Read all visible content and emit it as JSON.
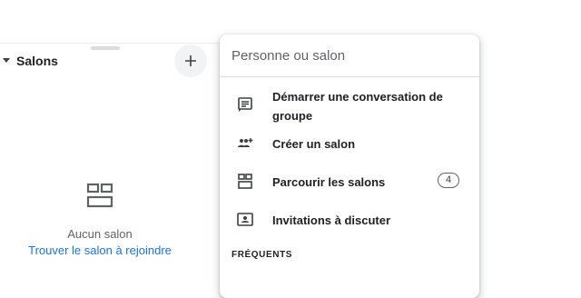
{
  "left": {
    "section_title": "Salons",
    "empty_title": "Aucun salon",
    "empty_link": "Trouver le salon à rejoindre",
    "add_label": "+"
  },
  "menu": {
    "search_placeholder": "Personne ou salon",
    "items": [
      {
        "label": "Démarrer une conversation de groupe",
        "icon": "group-chat-icon"
      },
      {
        "label": "Créer un salon",
        "icon": "create-space-icon"
      },
      {
        "label": "Parcourir les salons",
        "icon": "browse-spaces-icon",
        "badge": "4"
      },
      {
        "label": "Invitations à discuter",
        "icon": "invitations-icon"
      }
    ],
    "section_frequent": "FRÉQUENTS"
  }
}
